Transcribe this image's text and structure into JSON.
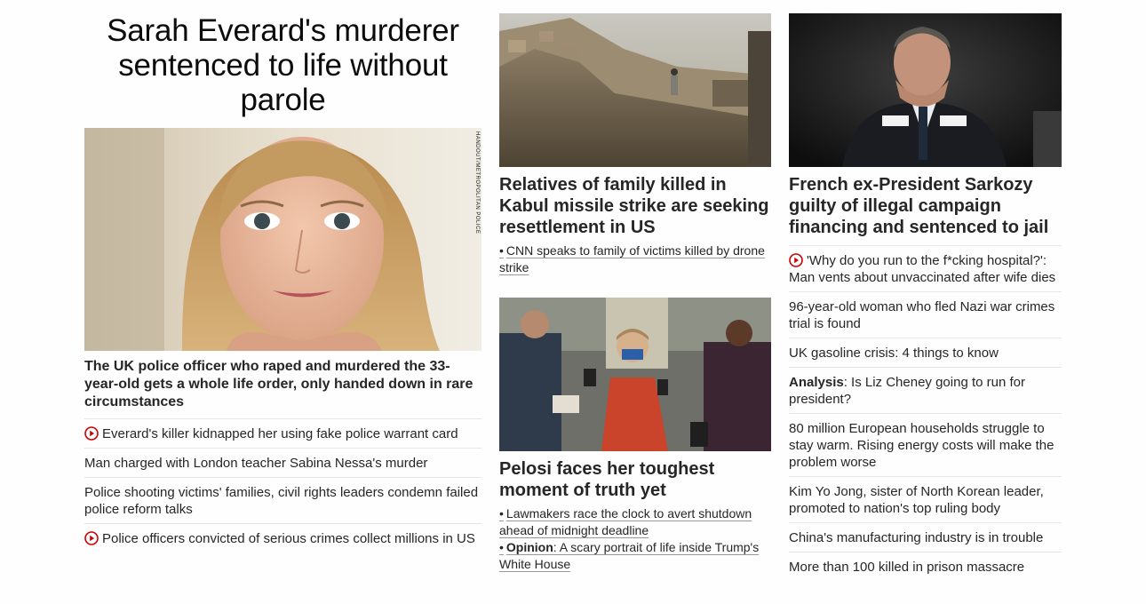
{
  "lead": {
    "headline": "Sarah Everard's murderer sentenced to life without parole",
    "image_credit": "HANDOUT/METROPOLITAN POLICE",
    "description": "The UK police officer who raped and murdered the 33-year-old gets a whole life order, only handed down in rare circumstances",
    "links": [
      {
        "label": "Everard's killer kidnapped her using fake police warrant card",
        "video": true
      },
      {
        "label": "Man charged with London teacher Sabina Nessa's murder",
        "video": false
      },
      {
        "label": "Police shooting victims' families, civil rights leaders condemn failed police reform talks",
        "video": false
      },
      {
        "label": "Police officers convicted of serious crimes collect millions in US",
        "video": true
      }
    ]
  },
  "kabul": {
    "headline": "Relatives of family killed in Kabul missile strike are seeking resettlement in US",
    "sublinks": [
      {
        "prefix": "•",
        "label": "CNN speaks to family of victims killed by drone strike"
      }
    ]
  },
  "pelosi": {
    "headline": "Pelosi faces her toughest moment of truth yet",
    "sublinks": [
      {
        "prefix": "•",
        "label": "Lawmakers race the clock to avert shutdown ahead of midnight deadline"
      },
      {
        "prefix": "•",
        "bold": "Opinion",
        "label": ": A scary portrait of life inside Trump's White House"
      }
    ]
  },
  "sarkozy": {
    "headline": "French ex-President Sarkozy guilty of illegal campaign financing and sentenced to jail",
    "links": [
      {
        "label": "'Why do you run to the f*cking hospital?': Man vents about unvaccinated after wife dies",
        "video": true
      },
      {
        "label": "96-year-old woman who fled Nazi war crimes trial is found",
        "video": false
      },
      {
        "label": "UK gasoline crisis: 4 things to know",
        "video": false
      },
      {
        "bold": "Analysis",
        "label": ": Is Liz Cheney going to run for president?",
        "video": false
      },
      {
        "label": "80 million European households struggle to stay warm. Rising energy costs will make the problem worse",
        "video": false
      },
      {
        "label": "Kim Yo Jong, sister of North Korean leader, promoted to nation's top ruling body",
        "video": false
      },
      {
        "label": "China's manufacturing industry is in trouble",
        "video": false
      },
      {
        "label": "More than 100 killed in prison massacre",
        "video": false
      }
    ]
  },
  "colors": {
    "video_icon": "#cc0000",
    "divider": "#e6e6e6",
    "text": "#262626"
  }
}
